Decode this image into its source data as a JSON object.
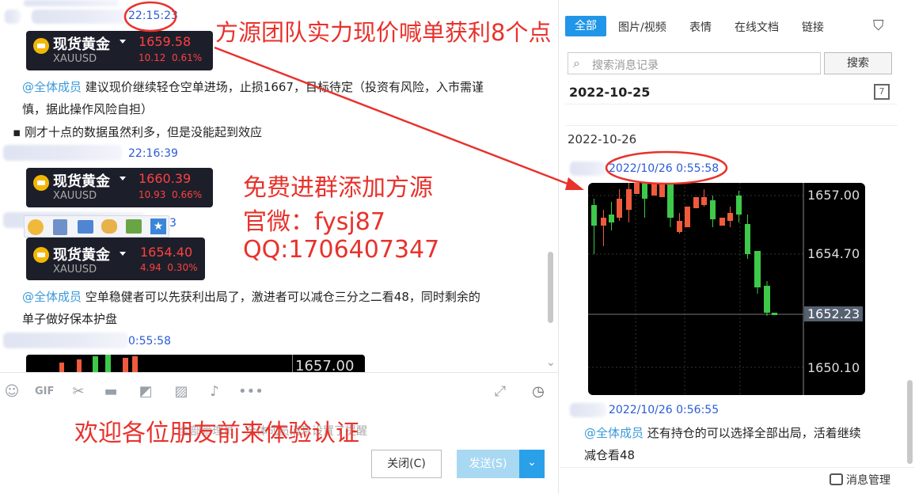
{
  "left": {
    "ts_top": "22:15:23",
    "cards": [
      {
        "name": "现货黄金",
        "code": "XAUUSD",
        "price": "1659.58",
        "change": "10.12",
        "pct": "0.61%"
      },
      {
        "name": "现货黄金",
        "code": "XAUUSD",
        "price": "1660.39",
        "change": "10.93",
        "pct": "0.66%"
      },
      {
        "name": "现货黄金",
        "code": "XAUUSD",
        "price": "1654.40",
        "change": "4.94",
        "pct": "0.30%"
      }
    ],
    "mention": "@全体成员",
    "msg1": "建议现价继续轻仓空单进场，止损1667，目标待定（投资有风险，入市需谨",
    "msg1b": "慎，据此操作风险自担）",
    "msg2": "刚才十点的数据虽然利多，但是没能起到效应",
    "ts2": "22:16:39",
    "ts3": "3",
    "msg3": "空单稳健者可以先获利出局了，激进者可以减仓三分之二看48，同时剩余的",
    "msg3b": "单子做好保本护盘",
    "ts4": "0:55:58",
    "chart_peek_label": "1657.00"
  },
  "overlay": {
    "headline": "方源团队实力现价喊单获利8个点",
    "promo1": "免费进群添加方源",
    "promo2": "官微：fysj87",
    "promo3": "QQ:1706407347",
    "welcome": "欢迎各位朋友前来体验认证",
    "input_hint": "全部管理员，全体成员消息设置了提醒"
  },
  "footer": {
    "close": "关闭(C)",
    "send": "发送(S)"
  },
  "right": {
    "tabs": [
      "全部",
      "图片/视频",
      "表情",
      "在线文档",
      "链接"
    ],
    "search_placeholder": "搜索消息记录",
    "search_button": "搜索",
    "date1": "2022-10-25",
    "date2": "2022-10-26",
    "ts1": "2022/10/26 0:55:58",
    "ts2": "2022/10/26 0:56:55",
    "mention": "@全体成员",
    "msg": "还有持仓的可以选择全部出局，活着继续",
    "msg_b": "减仓看48",
    "manage": "消息管理",
    "price_labels": [
      "1657.00",
      "1654.70",
      "1652.23",
      "1650.10"
    ]
  },
  "colors": {
    "red": "#e8322c",
    "green": "#3ec94a",
    "up_bar": "#ef5b3c"
  }
}
